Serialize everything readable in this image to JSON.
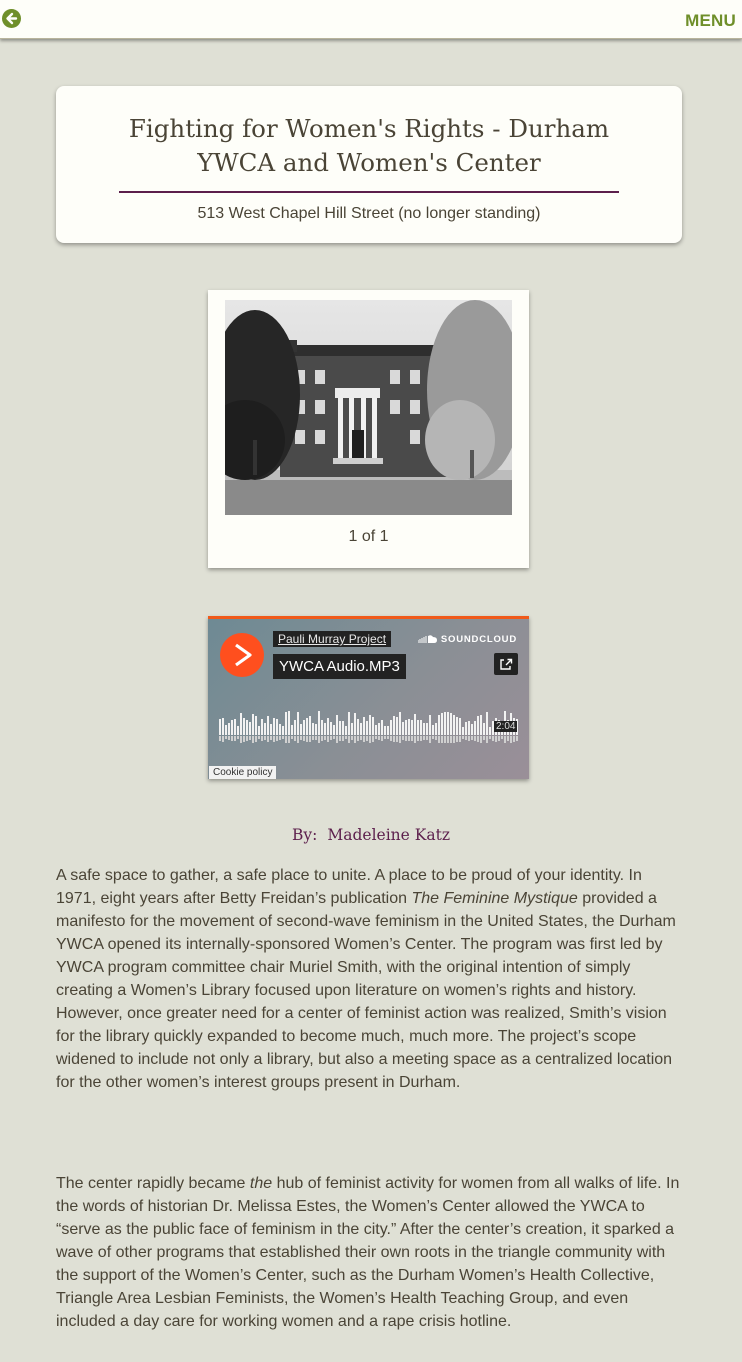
{
  "nav": {
    "back_icon": "arrow-left-circle-icon",
    "menu_label": "MENU",
    "accent_color": "#6f8f2a"
  },
  "header": {
    "title": "Fighting for Women's Rights - Durham YWCA and Women's Center",
    "address": "513 West Chapel Hill Street (no longer standing)",
    "rule_color": "#5c1f4c"
  },
  "gallery": {
    "image_alt": "Black and white photo of the Durham YWCA building",
    "counter": "1 of 1"
  },
  "audio_player": {
    "service": "SOUNDCLOUD",
    "user": "Pauli Murray Project",
    "track_title": "YWCA Audio.MP3",
    "duration": "2:04",
    "cookie_label": "Cookie policy",
    "play_icon": "play-icon",
    "share_icon": "share-icon",
    "accent_color": "#ff4f1e"
  },
  "byline": {
    "prefix": "By:",
    "author": "Madeleine Katz"
  },
  "article": {
    "p1_part1": "A safe space to gather, a safe place to unite. A place to be proud of your identity.  In 1971, eight years after Betty Freidan’s publication ",
    "p1_italic": "The Feminine Mystique",
    "p1_part2": " provided a manifesto for the movement of second-wave feminism in the United States, the Durham YWCA opened its internally-sponsored Women’s Center. The program was first led by YWCA program committee chair Muriel Smith, with the original intention of simply creating a Women’s Library focused upon literature on women’s rights and history. However, once greater need for a center of feminist action was realized, Smith’s vision for the library quickly expanded to become much, much more. The project’s scope widened to include not only a library, but also a meeting space as a centralized location for the other women’s interest groups present in Durham.",
    "p2_part1": "The center rapidly became ",
    "p2_italic": "the",
    "p2_part2": " hub of feminist activity for women from all walks of life. In the words of historian Dr. Melissa Estes, the Women’s Center allowed the YWCA to “serve as the public face of feminism in the city.” After the center’s creation, it sparked a wave of other programs that established their own roots in the triangle community with the support of the Women’s Center, such as the Durham Women’s Health Collective, Triangle Area Lesbian Feminists, the Women’s Health Teaching Group, and even included a day care for working women and a rape crisis hotline."
  }
}
